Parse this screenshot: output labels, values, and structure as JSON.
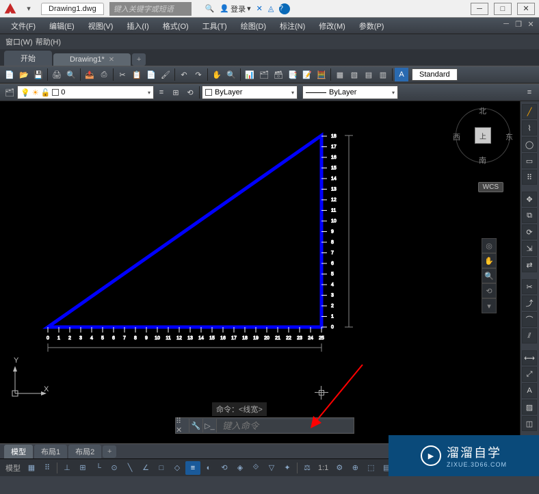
{
  "title_tab": "Drawing1.dwg",
  "search_placeholder": "键入关键字或短语",
  "login_label": "登录",
  "menus": {
    "file": "文件(F)",
    "edit": "编辑(E)",
    "view": "视图(V)",
    "insert": "插入(I)",
    "format": "格式(O)",
    "tools": "工具(T)",
    "draw": "绘图(D)",
    "dim": "标注(N)",
    "modify": "修改(M)",
    "param": "参数(P)",
    "window": "窗口(W)",
    "help": "帮助(H)"
  },
  "doc_tabs": {
    "start": "开始",
    "drawing": "Drawing1*"
  },
  "layer_name": "0",
  "color_label": "ByLayer",
  "linetype_label": "ByLayer",
  "style_label": "Standard",
  "viewcube": {
    "n": "北",
    "s": "南",
    "e": "东",
    "w": "西",
    "face": "上",
    "wcs": "WCS"
  },
  "ucs": {
    "x": "X",
    "y": "Y"
  },
  "cmd_history": "命令：<线宽>",
  "cmd_placeholder": "键入命令",
  "layout_tabs": {
    "model": "模型",
    "l1": "布局1",
    "l2": "布局2"
  },
  "status": {
    "model": "模型",
    "scale": "1:1"
  },
  "watermark": {
    "brand": "溜溜自学",
    "url": "ZIXUE.3D66.COM"
  },
  "ruler": {
    "x_ticks": [
      "0",
      "1",
      "2",
      "3",
      "4",
      "5",
      "6",
      "7",
      "8",
      "9",
      "10",
      "11",
      "12",
      "13",
      "14",
      "15",
      "16",
      "17",
      "18",
      "19",
      "20",
      "21",
      "22",
      "23",
      "24",
      "25"
    ],
    "y_ticks": [
      "0",
      "1",
      "2",
      "3",
      "4",
      "5",
      "6",
      "7",
      "8",
      "9",
      "10",
      "11",
      "12",
      "13",
      "14",
      "15",
      "16",
      "17",
      "18"
    ]
  }
}
